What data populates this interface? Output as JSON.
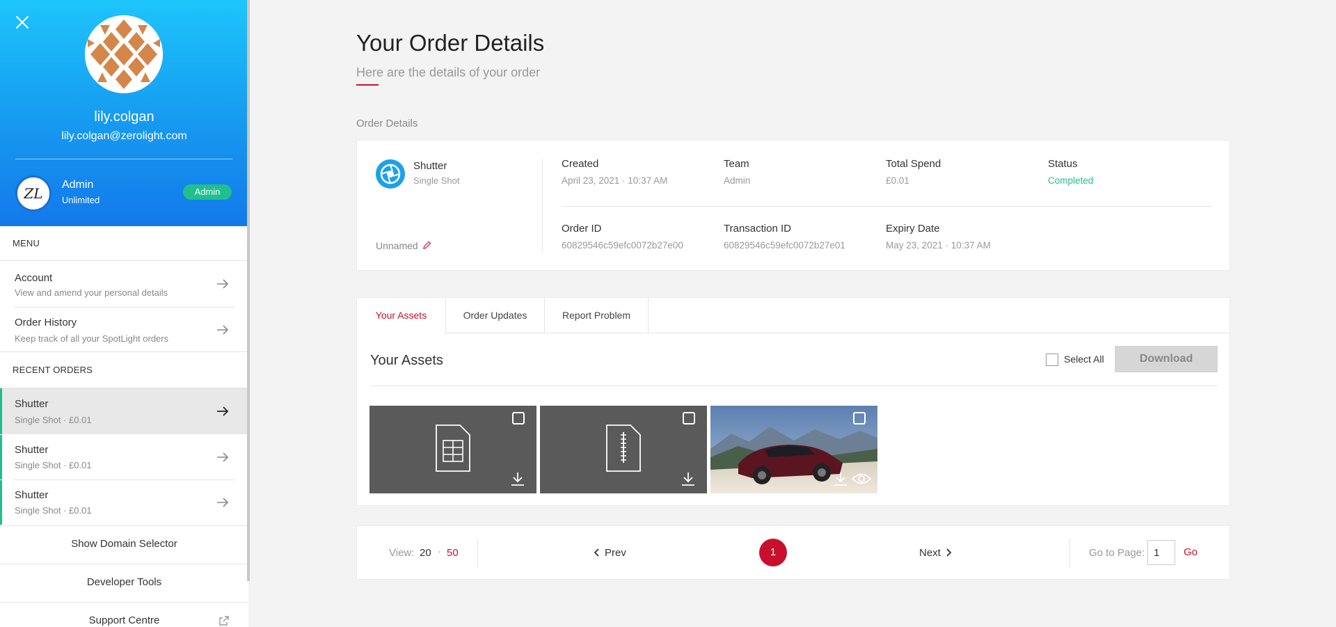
{
  "profile": {
    "username": "lily.colgan",
    "email": "lily.colgan@zerolight.com",
    "domain_logo_text": "ZL",
    "domain_name": "Admin",
    "domain_plan": "Unlimited",
    "role_badge": "Admin"
  },
  "menu": {
    "heading": "MENU",
    "items": [
      {
        "title": "Account",
        "subtitle": "View and amend your personal details"
      },
      {
        "title": "Order History",
        "subtitle": "Keep track of all your SpotLight orders"
      }
    ]
  },
  "recent_orders": {
    "heading": "RECENT ORDERS",
    "items": [
      {
        "title": "Shutter",
        "subtitle": "Single Shot · £0.01"
      },
      {
        "title": "Shutter",
        "subtitle": "Single Shot · £0.01"
      },
      {
        "title": "Shutter",
        "subtitle": "Single Shot · £0.01"
      }
    ]
  },
  "sidebar_links": {
    "domain_selector": "Show Domain Selector",
    "developer_tools": "Developer Tools",
    "support_centre": "Support Centre"
  },
  "page": {
    "title": "Your Order Details",
    "subtitle": "Here are the details of your order",
    "section_label": "Order Details"
  },
  "order": {
    "product_name": "Shutter",
    "product_type": "Single Shot",
    "name": "Unnamed",
    "fields": {
      "created_label": "Created",
      "created_value": "April 23, 2021 · 10:37 AM",
      "team_label": "Team",
      "team_value": "Admin",
      "spend_label": "Total Spend",
      "spend_value": "£0.01",
      "status_label": "Status",
      "status_value": "Completed",
      "order_id_label": "Order ID",
      "order_id_value": "60829546c59efc0072b27e00",
      "transaction_id_label": "Transaction ID",
      "transaction_id_value": "60829546c59efc0072b27e01",
      "expiry_label": "Expiry Date",
      "expiry_value": "May 23, 2021 · 10:37 AM"
    }
  },
  "tabs": [
    "Your Assets",
    "Order Updates",
    "Report Problem"
  ],
  "assets": {
    "title": "Your Assets",
    "select_all": "Select All",
    "download": "Download"
  },
  "pagination": {
    "view_label": "View:",
    "view_20": "20",
    "view_50": "50",
    "separator": "·",
    "prev": "Prev",
    "current_page": "1",
    "next": "Next",
    "goto_label": "Go to Page:",
    "goto_value": "1",
    "go": "Go"
  },
  "colors": {
    "accent": "#c8102e",
    "status_completed": "#1fc08d",
    "profile_gradient_top": "#1ec5fb",
    "profile_gradient_bottom": "#1379ea"
  }
}
